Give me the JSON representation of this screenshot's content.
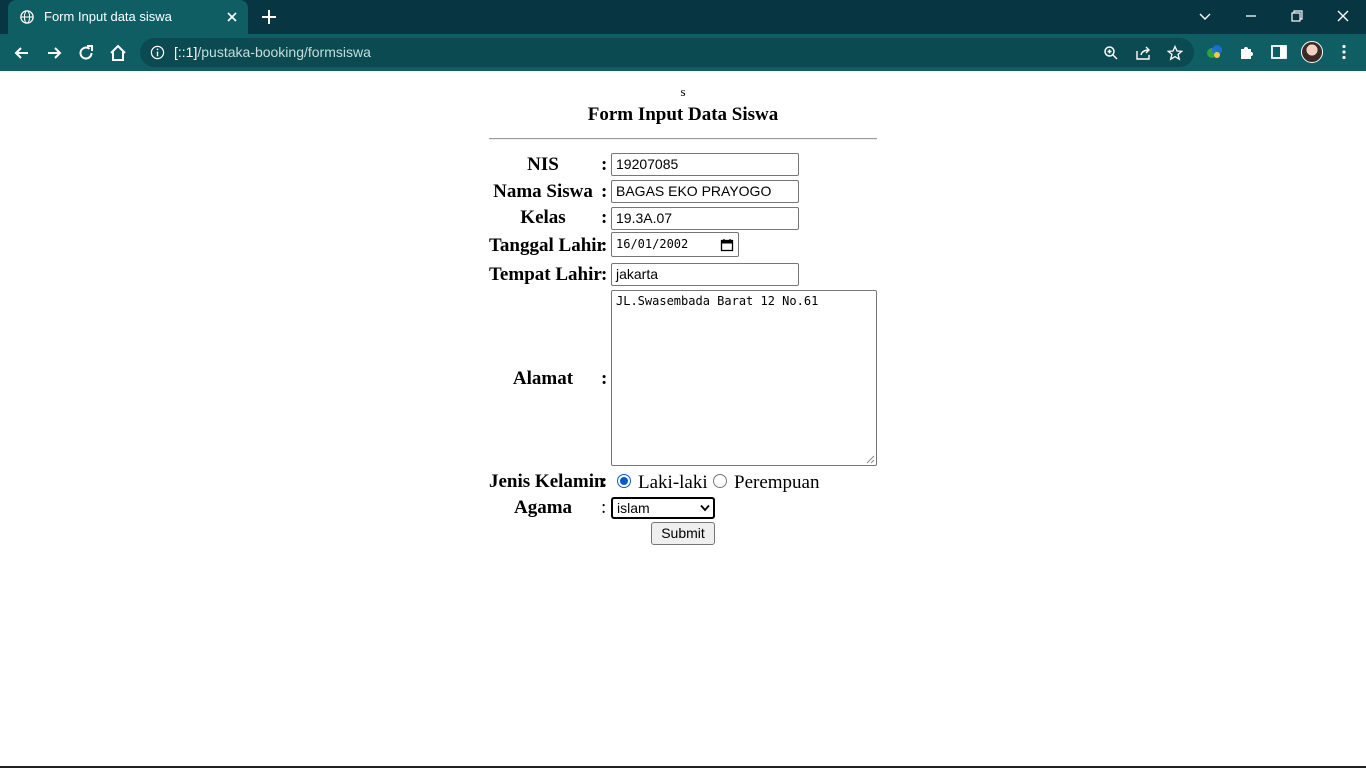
{
  "browser": {
    "tab_title": "Form Input data siswa",
    "url_host": "[::1]",
    "url_path": "/pustaka-booking/formsiswa",
    "accent_color": "#0e5e64",
    "tabbar_color": "#073642"
  },
  "page": {
    "header_text": "s",
    "form_title": "Form Input Data Siswa",
    "colon": ":",
    "fields": {
      "nis": {
        "label": "NIS",
        "value": "19207085"
      },
      "nama": {
        "label": "Nama Siswa",
        "value": "BAGAS EKO PRAYOGO"
      },
      "kelas": {
        "label": "Kelas",
        "value": "19.3A.07"
      },
      "tanggal_lahir": {
        "label": "Tanggal Lahir",
        "value": "16/01/2002"
      },
      "tempat_lahir": {
        "label": "Tempat Lahir",
        "value": "jakarta"
      },
      "alamat": {
        "label": "Alamat",
        "value": "JL.Swasembada Barat 12 No.61"
      },
      "jenis_kelamin": {
        "label": "Jenis Kelamin",
        "options": [
          "Laki-laki",
          "Perempuan"
        ],
        "selected": "Laki-laki"
      },
      "agama": {
        "label": "Agama",
        "selected": "islam"
      }
    },
    "submit_label": "Submit"
  }
}
